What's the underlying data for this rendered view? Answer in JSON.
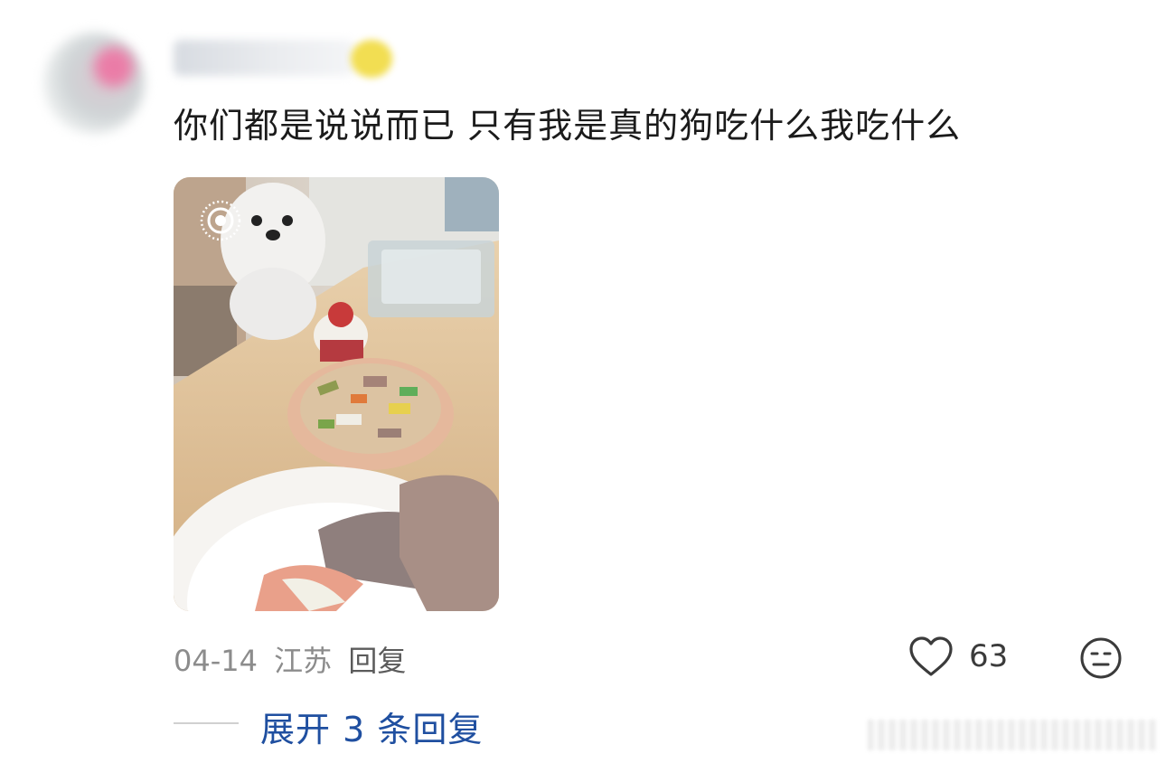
{
  "comment": {
    "text": "你们都是说说而已 只有我是真的狗吃什么我吃什么",
    "date": "04-14",
    "location": "江苏",
    "reply_label": "回复",
    "like_count": "63",
    "expand_replies": "展开 3 条回复"
  },
  "icons": {
    "like": "heart-outline-icon",
    "emoji": "neutral-face-icon",
    "live_photo": "live-photo-icon"
  },
  "colors": {
    "link": "#1f4fa0",
    "meta": "#8c8c8c"
  }
}
